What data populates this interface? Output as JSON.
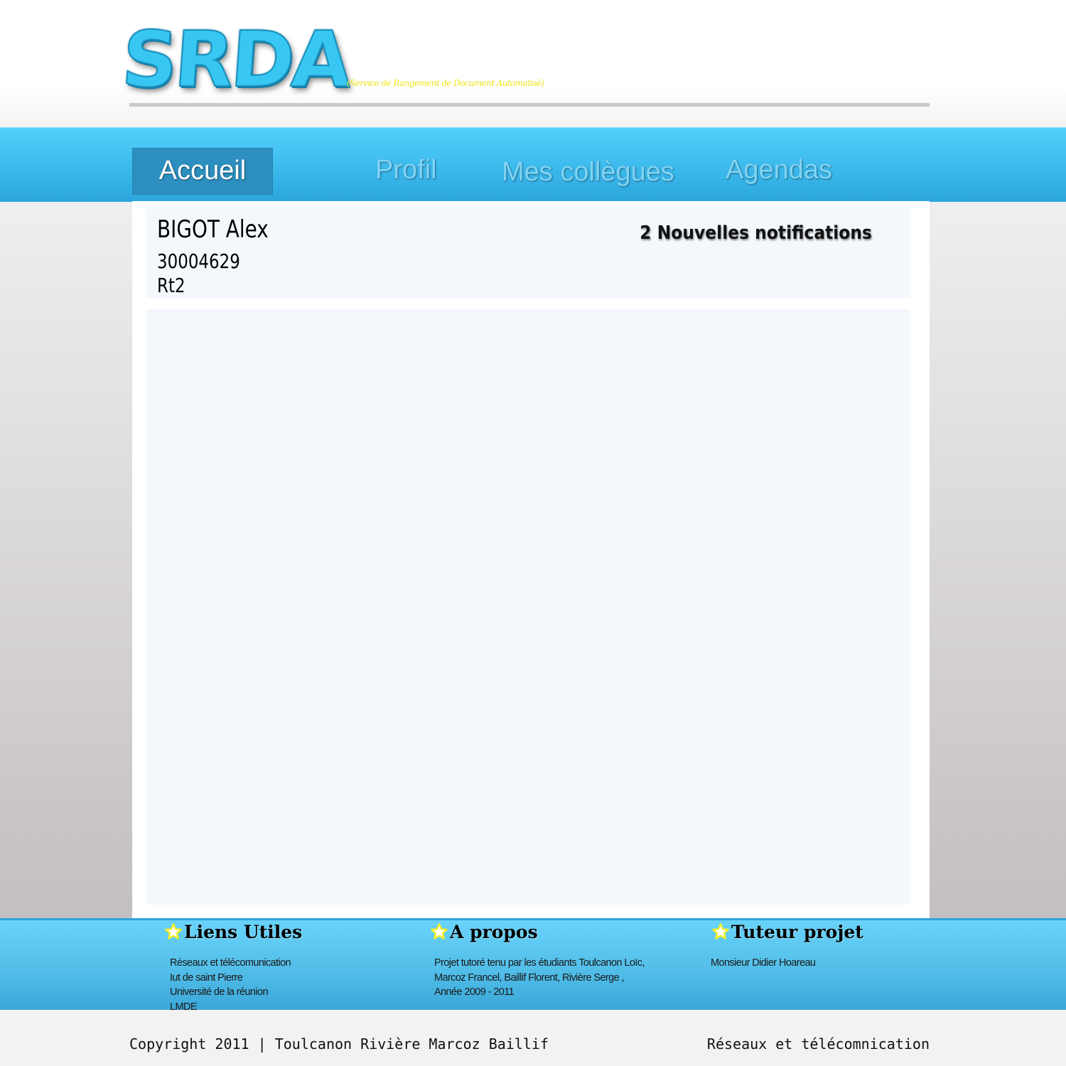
{
  "header": {
    "logo_text": "SRDA",
    "tagline": "(Service de Rangement de Document Automatisé)"
  },
  "nav": {
    "items": [
      {
        "label": "Accueil",
        "active": true
      },
      {
        "label": "Profil",
        "active": false
      },
      {
        "label": "Mes collègues",
        "active": false
      },
      {
        "label": "Agendas",
        "active": false
      }
    ]
  },
  "user": {
    "name": "BIGOT Alex",
    "id": "30004629",
    "group": "Rt2"
  },
  "notifications": {
    "label": "2 Nouvelles notifications"
  },
  "footer": {
    "columns": [
      {
        "title": "Liens Utiles",
        "lines": [
          "Réseaux et télécomunication",
          "Iut de saint Pierre",
          "Université de la réunion",
          "LMDE"
        ]
      },
      {
        "title": "A propos",
        "lines": [
          "Projet tutoré tenu par les étudiants Toulcanon Loïc,",
          "Marcoz Francel, Baillif Florent, Rivière Serge ,",
          "Année 2009 - 2011"
        ]
      },
      {
        "title": "Tuteur projet",
        "lines": [
          "Monsieur Didier Hoareau"
        ]
      }
    ],
    "icon": "star-icon",
    "icon_color": "#f2ee2a"
  },
  "bottom": {
    "copyright": "Copyright 2011 | Toulcanon Rivière Marcoz Baillif",
    "right_text": "Réseaux et télécomnication"
  },
  "colors": {
    "accent": "#3cb9ec",
    "nav_active": "#2d8fbf",
    "tagline": "#ece51c"
  }
}
